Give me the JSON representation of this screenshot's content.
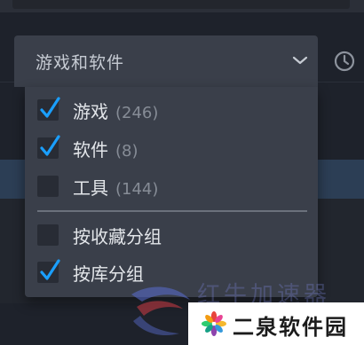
{
  "filter": {
    "selected_label": "游戏和软件",
    "icon": "chevron-down-icon"
  },
  "header": {
    "recent_icon": "clock-icon"
  },
  "menu": {
    "items": [
      {
        "label": "游戏",
        "count": "(246)",
        "checked": true
      },
      {
        "label": "软件",
        "count": "(8)",
        "checked": true
      },
      {
        "label": "工具",
        "count": "(144)",
        "checked": false
      },
      {
        "label": "按收藏分组",
        "count": "",
        "checked": false
      },
      {
        "label": "按库分组",
        "count": "",
        "checked": true
      }
    ]
  },
  "watermark": {
    "faded_text": "红牛加速器",
    "badge_text": "二泉软件园"
  },
  "colors": {
    "check_blue": "#1a9fff",
    "menu_bg": "#3a3f4a",
    "selected_row": "#2c3e55"
  }
}
